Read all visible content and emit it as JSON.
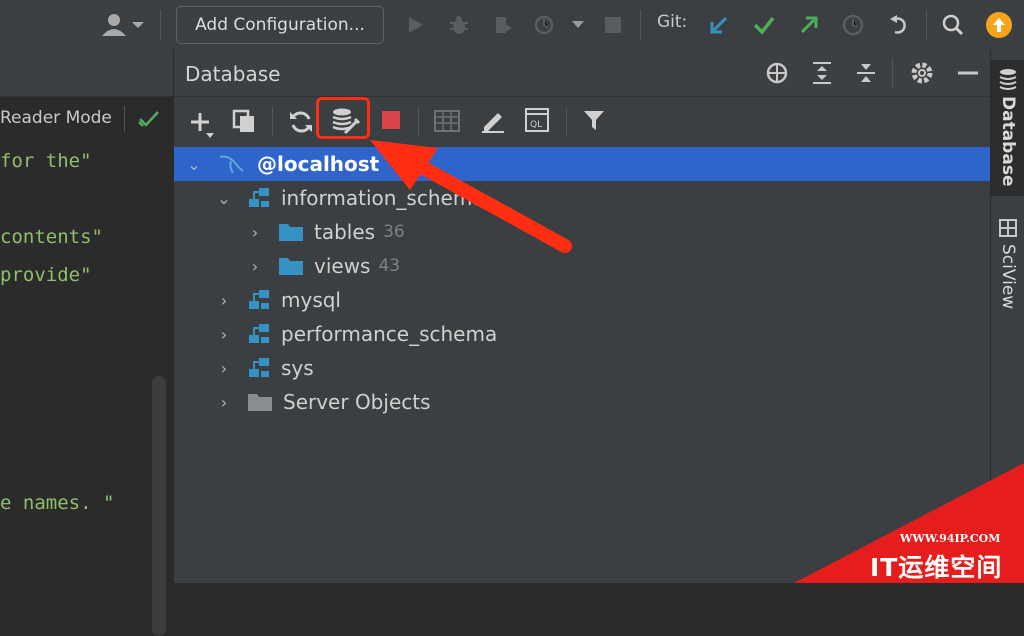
{
  "toolbar": {
    "add_configuration": "Add Configuration...",
    "git_label": "Git:"
  },
  "editor": {
    "reader_mode": "Reader Mode",
    "lines": [
      {
        "text": "for the\""
      },
      {
        "text": "contents\""
      },
      {
        "text": "provide\""
      },
      {
        "text": "e names. \""
      }
    ]
  },
  "database": {
    "title": "Database",
    "tree": [
      {
        "label": "@localhost",
        "count": ""
      },
      {
        "label": "information_schema",
        "count": ""
      },
      {
        "label": "tables",
        "count": "36"
      },
      {
        "label": "views",
        "count": "43"
      },
      {
        "label": "mysql",
        "count": ""
      },
      {
        "label": "performance_schema",
        "count": ""
      },
      {
        "label": "sys",
        "count": ""
      },
      {
        "label": "Server Objects",
        "count": ""
      }
    ]
  },
  "stripe": {
    "database_tab": "Database",
    "sciview_tab": "SciView"
  },
  "watermark": {
    "url": "WWW.94IP.COM",
    "brand": "IT运维空间"
  },
  "colors": {
    "selection": "#2f65ca",
    "highlight": "#ff2d12",
    "folder": "#3592c4",
    "git_update": "#3592c4",
    "git_commit": "#4fae5c",
    "update_badge": "#f7a31c"
  }
}
